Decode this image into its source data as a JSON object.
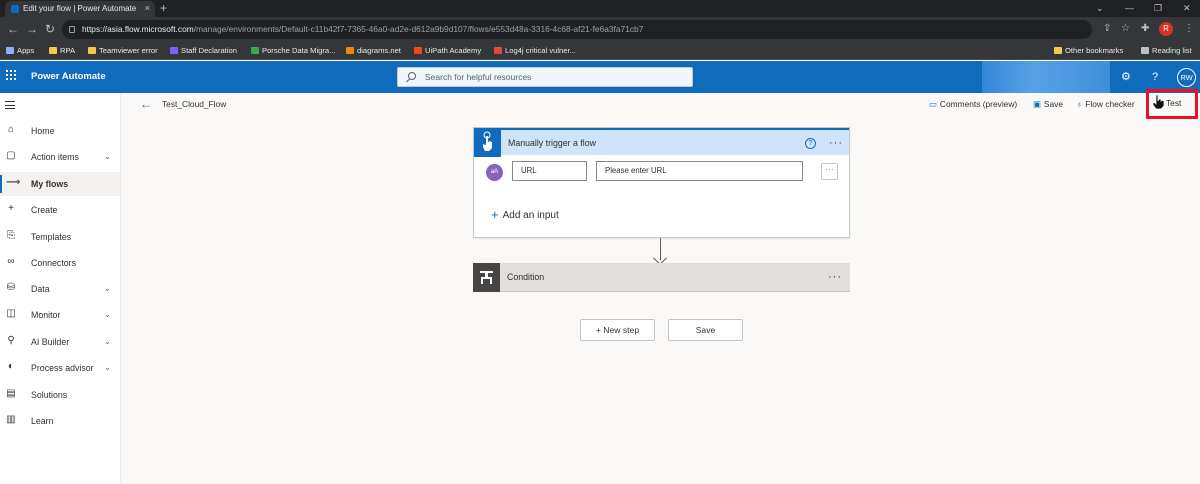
{
  "browser": {
    "tab_title": "Edit your flow | Power Automate",
    "tab_close": "×",
    "new_tab": "+",
    "url_host": "https://asia.flow.microsoft.com",
    "url_path": "/manage/environments/Default-c11b42f7-7365-46a0-ad2e-d612a9b9d107/flows/e553d48a-3316-4c68-af21-fe6a3fa71cb7",
    "profile_initial": "R",
    "window_buttons": [
      "⌄",
      "—",
      "❐",
      "✕"
    ],
    "bookmarks": [
      {
        "label": "Apps",
        "color": "#8ab4f8"
      },
      {
        "label": "RPA",
        "color": "#f2c94c"
      },
      {
        "label": "Teamviewer error",
        "color": "#f2c94c"
      },
      {
        "label": "Staff Declaration",
        "color": "#7b61ff"
      },
      {
        "label": "Porsche Data Migra...",
        "color": "#34a853"
      },
      {
        "label": "diagrams.net",
        "color": "#f08705"
      },
      {
        "label": "UiPath Academy",
        "color": "#fa4616"
      },
      {
        "label": "Log4j critical vulner...",
        "color": "#e8453c"
      }
    ],
    "other_bookmarks": "Other bookmarks",
    "reading_list": "Reading list"
  },
  "app": {
    "name": "Power Automate",
    "search_placeholder": "Search for helpful resources",
    "settings_icon": "⚙",
    "help_icon": "?",
    "user_initials": "RW",
    "accent": "#0f6cbd"
  },
  "nav": {
    "items": [
      {
        "label": "Home",
        "icon": "⌂",
        "chevron": false,
        "active": false
      },
      {
        "label": "Action items",
        "icon": "▢",
        "chevron": true,
        "active": false
      },
      {
        "label": "My flows",
        "icon": "⟿",
        "chevron": false,
        "active": true
      },
      {
        "label": "Create",
        "icon": "+",
        "chevron": false,
        "active": false
      },
      {
        "label": "Templates",
        "icon": "⎘",
        "chevron": false,
        "active": false
      },
      {
        "label": "Connectors",
        "icon": "∞",
        "chevron": false,
        "active": false
      },
      {
        "label": "Data",
        "icon": "⛁",
        "chevron": true,
        "active": false
      },
      {
        "label": "Monitor",
        "icon": "◫",
        "chevron": true,
        "active": false
      },
      {
        "label": "AI Builder",
        "icon": "⚲",
        "chevron": true,
        "active": false
      },
      {
        "label": "Process advisor",
        "icon": "◐",
        "chevron": true,
        "active": false
      },
      {
        "label": "Solutions",
        "icon": "▤",
        "chevron": false,
        "active": false
      },
      {
        "label": "Learn",
        "icon": "▥",
        "chevron": false,
        "active": false
      }
    ]
  },
  "command_bar": {
    "flow_name": "Test_Cloud_Flow",
    "comments": "Comments (preview)",
    "save": "Save",
    "flow_checker": "Flow checker",
    "test": "Test"
  },
  "trigger": {
    "title": "Manually trigger a flow",
    "help": "?",
    "more": "···",
    "input_avatar": "aA",
    "input_name": "URL",
    "input_placeholder": "Please enter URL",
    "input_more": "···",
    "add_input": "Add an input"
  },
  "condition": {
    "title": "Condition",
    "more": "···"
  },
  "actions": {
    "new_step": "+ New step",
    "save": "Save"
  }
}
